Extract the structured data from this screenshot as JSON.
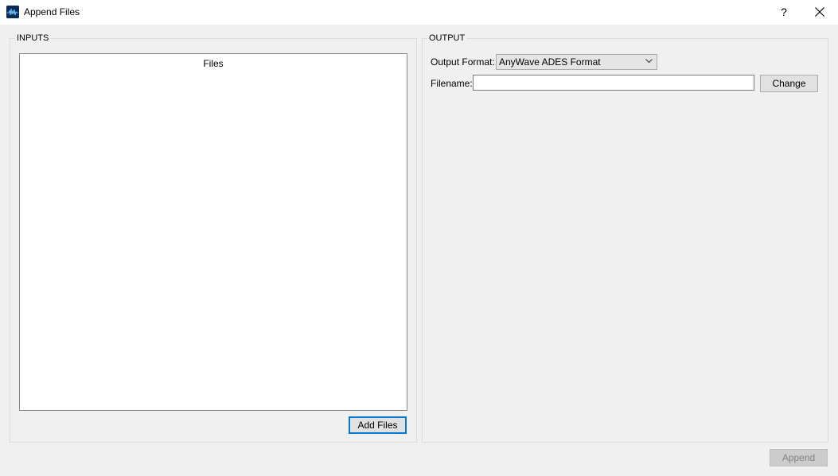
{
  "window": {
    "title": "Append Files",
    "icon": "app-waveform-icon",
    "help_label": "?",
    "close_icon": "close-icon"
  },
  "inputs": {
    "group_title": "INPUTS",
    "files_header": "Files",
    "files": [],
    "add_files_label": "Add Files"
  },
  "output": {
    "group_title": "OUTPUT",
    "format_label": "Output Format:",
    "format_value": "AnyWave ADES Format",
    "filename_label": "Filename:",
    "filename_value": "",
    "filename_placeholder": "",
    "change_label": "Change"
  },
  "footer": {
    "append_label": "Append",
    "append_enabled": false
  },
  "colors": {
    "focus_accent": "#0078d7",
    "window_bg": "#f0f0f0",
    "disabled_text": "#838383"
  }
}
